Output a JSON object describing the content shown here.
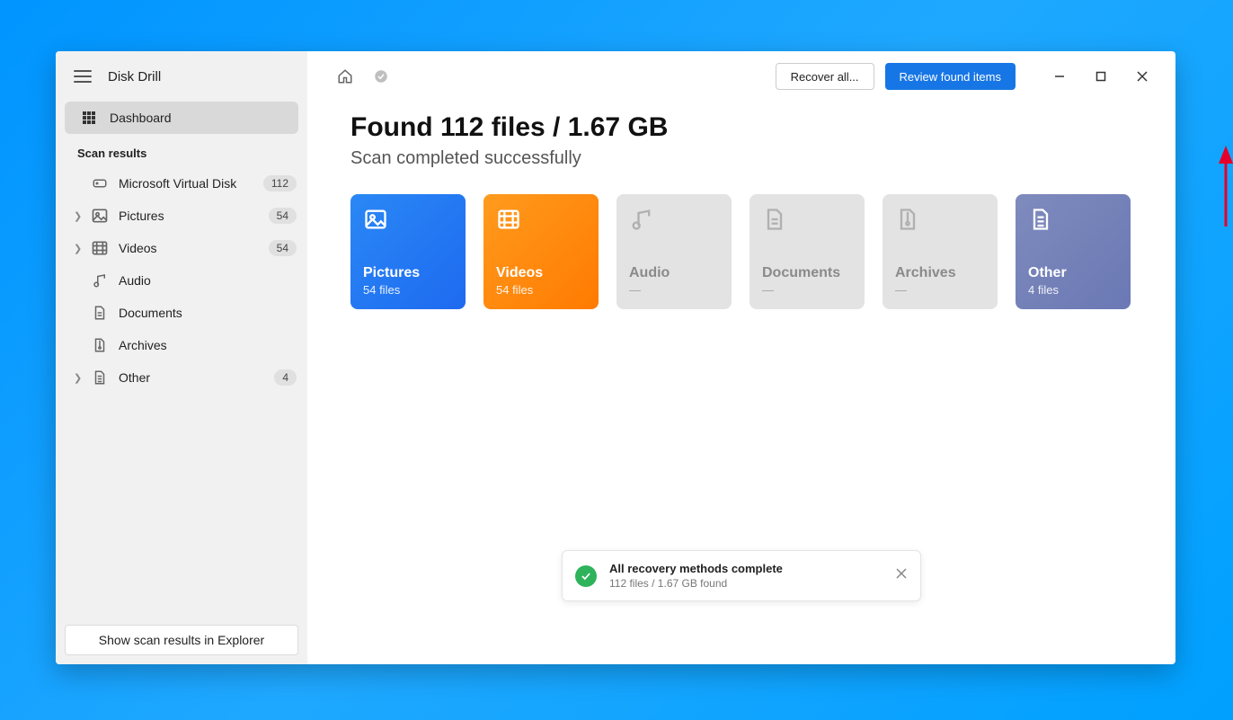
{
  "app": {
    "title": "Disk Drill"
  },
  "sidebar": {
    "dashboard_label": "Dashboard",
    "section_label": "Scan results",
    "items": [
      {
        "label": "Microsoft Virtual Disk",
        "count": "112",
        "expandable": false,
        "icon": "disk"
      },
      {
        "label": "Pictures",
        "count": "54",
        "expandable": true,
        "icon": "picture"
      },
      {
        "label": "Videos",
        "count": "54",
        "expandable": true,
        "icon": "video"
      },
      {
        "label": "Audio",
        "count": "",
        "expandable": false,
        "icon": "audio"
      },
      {
        "label": "Documents",
        "count": "",
        "expandable": false,
        "icon": "document"
      },
      {
        "label": "Archives",
        "count": "",
        "expandable": false,
        "icon": "archive"
      },
      {
        "label": "Other",
        "count": "4",
        "expandable": true,
        "icon": "other"
      }
    ],
    "footer_button": "Show scan results in Explorer"
  },
  "toolbar": {
    "recover_label": "Recover all...",
    "review_label": "Review found items"
  },
  "main": {
    "headline": "Found 112 files / 1.67 GB",
    "subline": "Scan completed successfully",
    "tiles": [
      {
        "title": "Pictures",
        "sub": "54 files",
        "style": "blue",
        "icon": "picture"
      },
      {
        "title": "Videos",
        "sub": "54 files",
        "style": "orange",
        "icon": "video"
      },
      {
        "title": "Audio",
        "sub": "—",
        "style": "gray",
        "icon": "audio"
      },
      {
        "title": "Documents",
        "sub": "—",
        "style": "gray",
        "icon": "document"
      },
      {
        "title": "Archives",
        "sub": "—",
        "style": "gray",
        "icon": "archive"
      },
      {
        "title": "Other",
        "sub": "4 files",
        "style": "slate",
        "icon": "other"
      }
    ]
  },
  "toast": {
    "title": "All recovery methods complete",
    "sub": "112 files / 1.67 GB found"
  }
}
